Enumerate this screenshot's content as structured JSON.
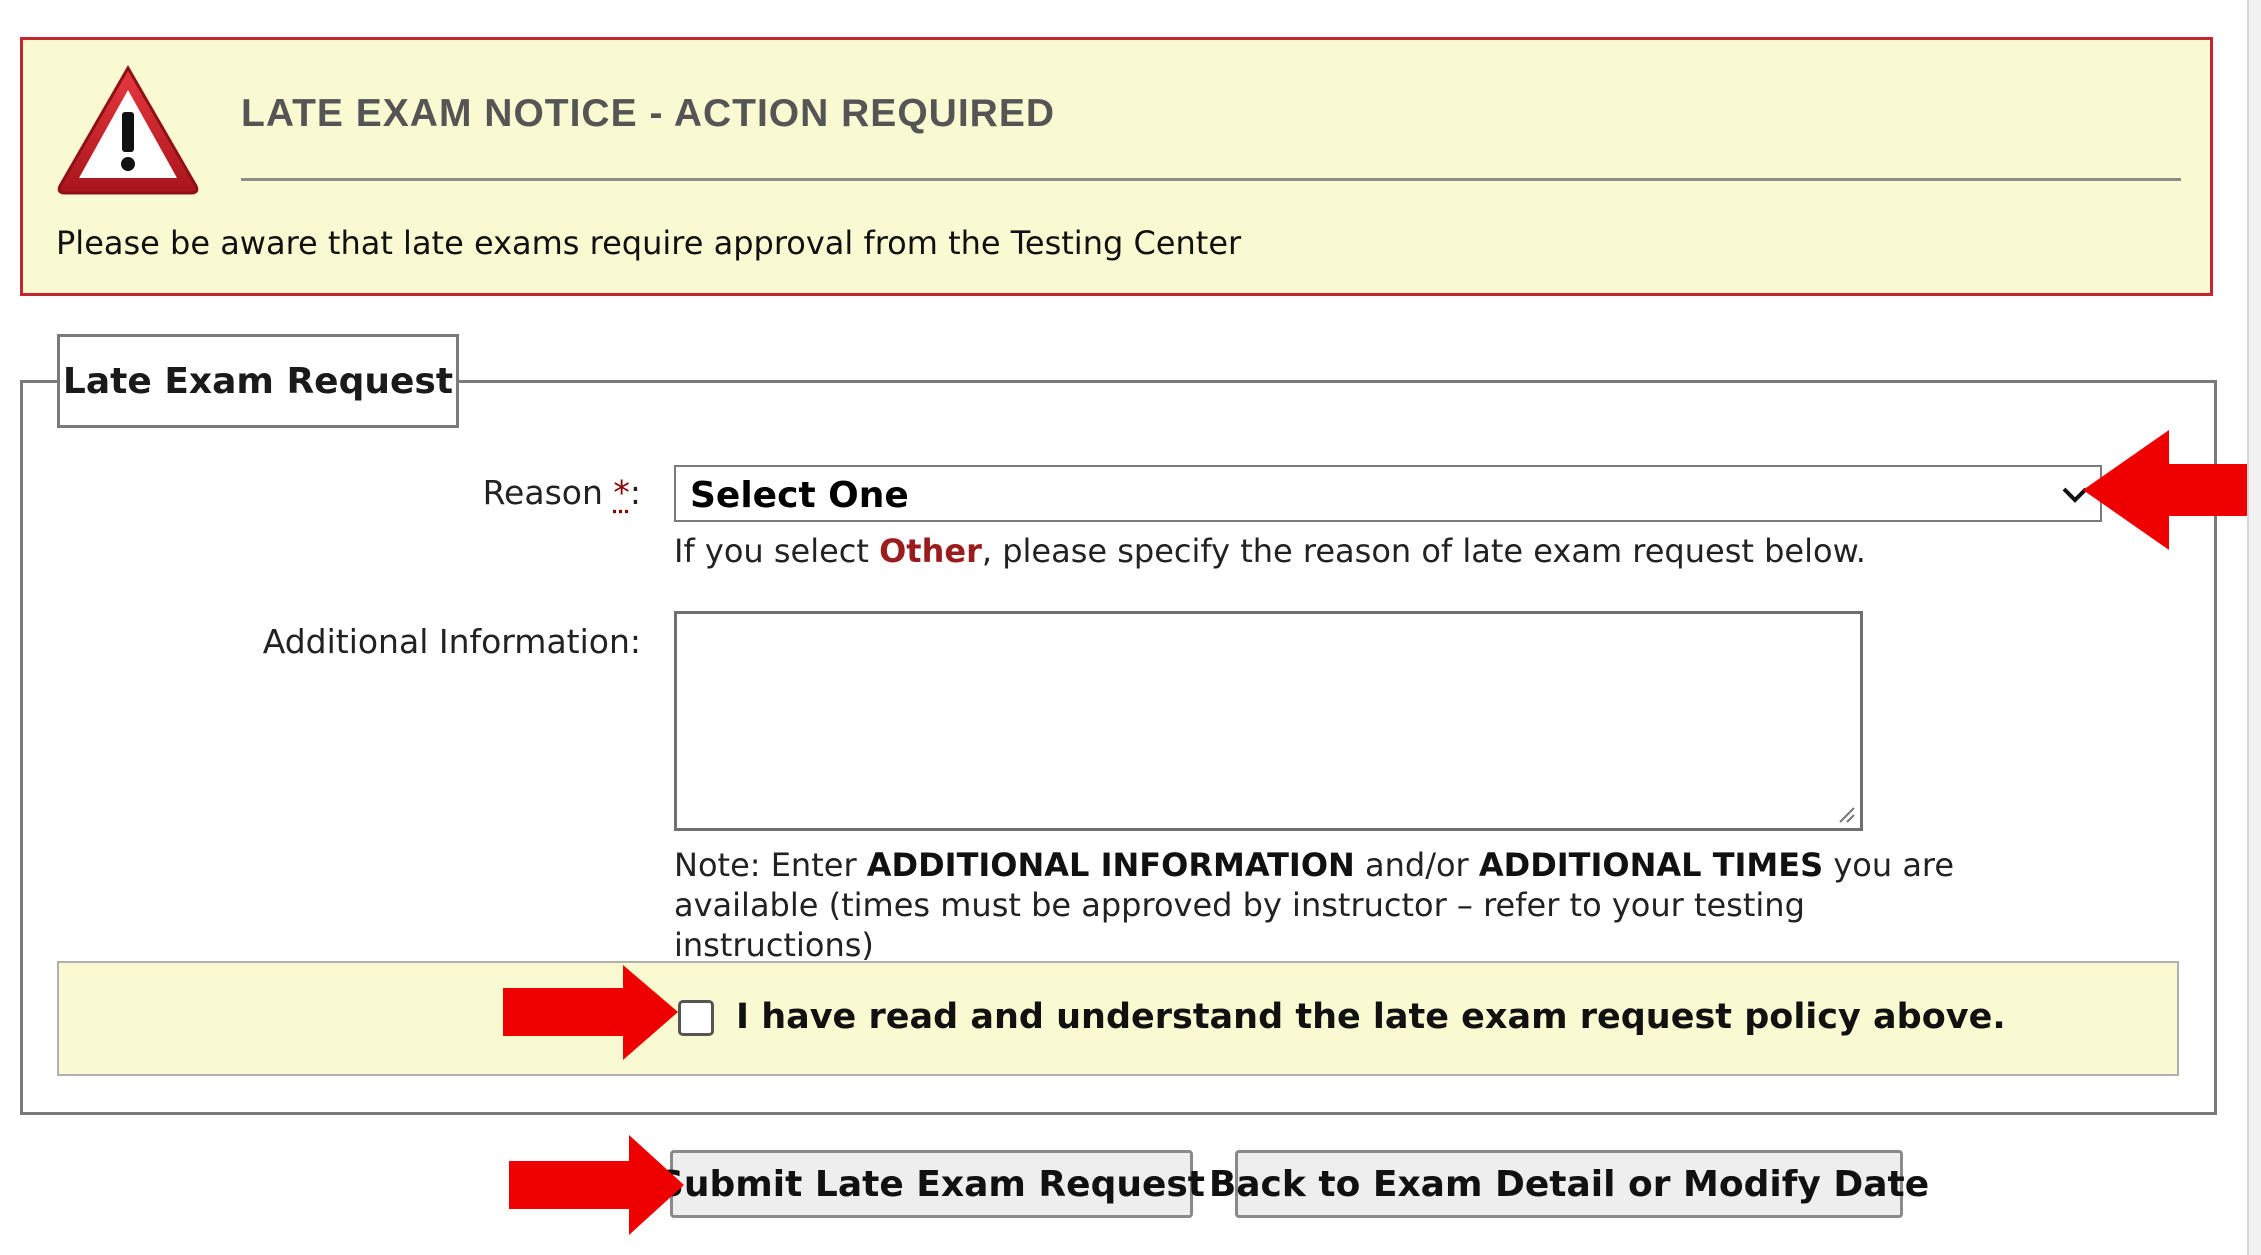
{
  "notice": {
    "title": "LATE EXAM NOTICE - ACTION REQUIRED",
    "message": "Please be aware that late exams require approval from the Testing Center",
    "icon": "warning-triangle-icon"
  },
  "form": {
    "legend": "Late Exam Request",
    "reason": {
      "label": "Reason ",
      "required_marker": "*",
      "label_suffix": ":",
      "selected_value": "Select One"
    },
    "hint": {
      "prefix": "If you select ",
      "highlight": "Other",
      "suffix": ", please specify the reason of late exam request below."
    },
    "additional_info": {
      "label": "Additional Information:",
      "value": ""
    },
    "note": {
      "prefix": "Note: Enter ",
      "bold1": "ADDITIONAL INFORMATION",
      "middle": " and/or ",
      "bold2": "ADDITIONAL TIMES",
      "suffix": " you are available (times must be approved by instructor – refer to your testing instructions)"
    },
    "agreement": {
      "label": "I have read and understand the late exam request policy above.",
      "checked": false
    }
  },
  "buttons": {
    "submit": "Submit Late Exam Request",
    "back": "Back to Exam Detail or Modify Date"
  },
  "colors": {
    "notice_border": "#c4262e",
    "notice_background": "#fafad2",
    "other_highlight": "#9b1c1c",
    "annotation_arrow": "#ee0000"
  }
}
